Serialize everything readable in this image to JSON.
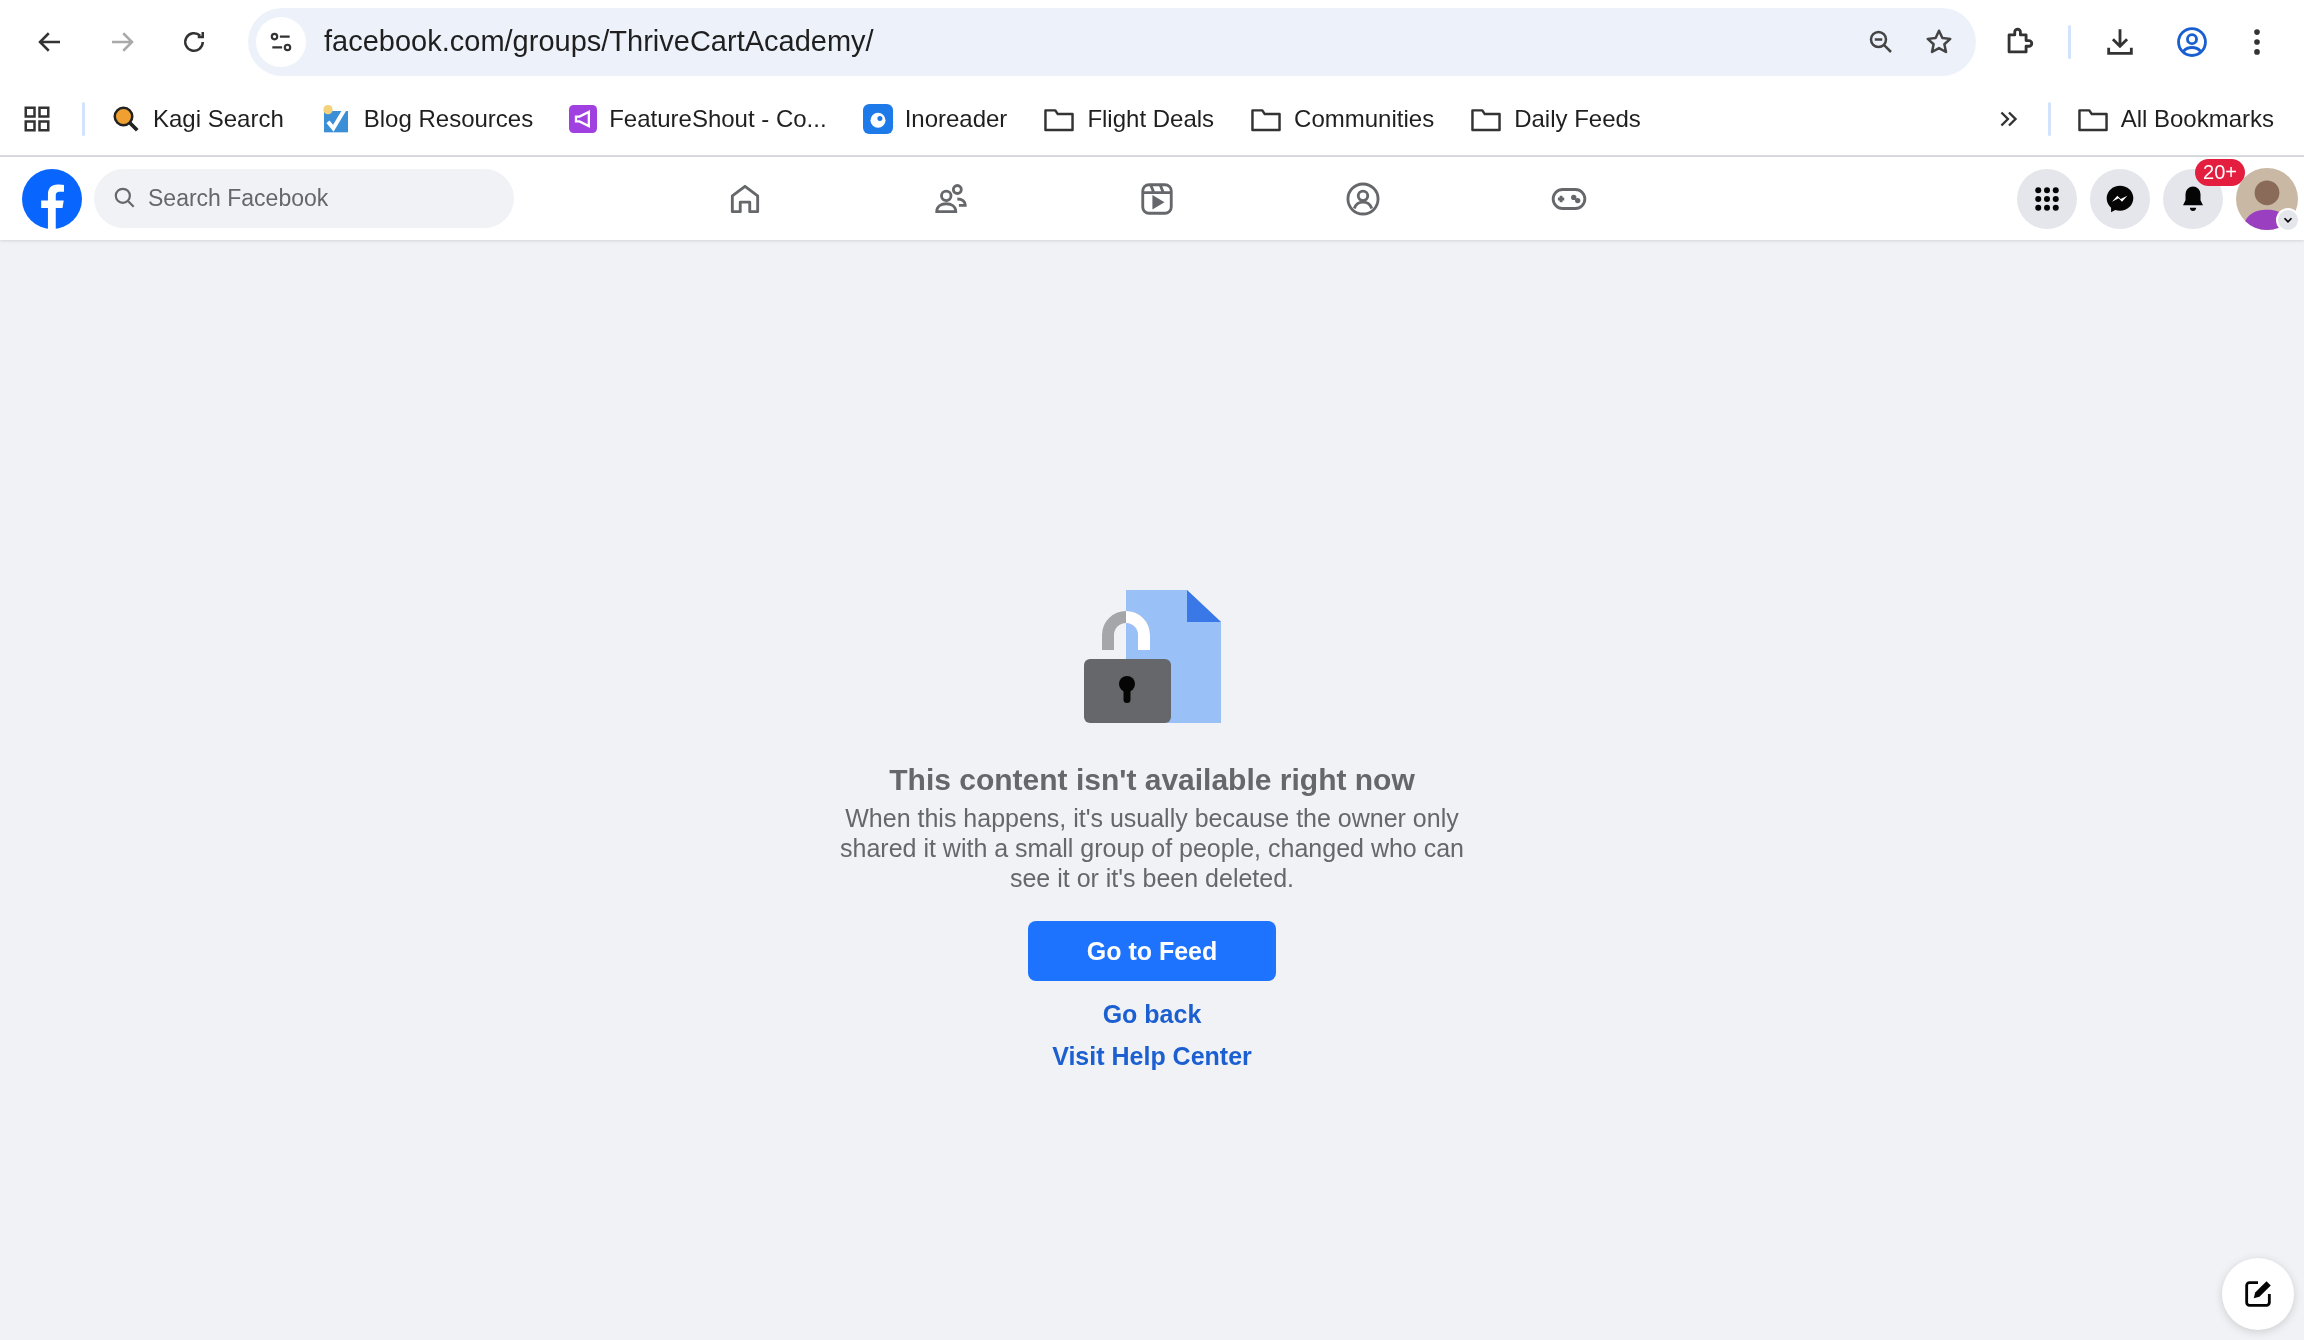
{
  "browser": {
    "nav_buttons": [
      {
        "kind": "back",
        "disabled": false
      },
      {
        "kind": "forward",
        "disabled": true
      },
      {
        "kind": "reload",
        "disabled": false
      }
    ],
    "url": "facebook.com/groups/ThriveCartAcademy/",
    "bookmarks": [
      {
        "kind": "kagi",
        "label": "Kagi Search"
      },
      {
        "kind": "blog",
        "label": "Blog Resources"
      },
      {
        "kind": "featureshout",
        "label": "FeatureShout - Co..."
      },
      {
        "kind": "inoreader",
        "label": "Inoreader"
      },
      {
        "kind": "folder",
        "label": "Flight Deals"
      },
      {
        "kind": "folder",
        "label": "Communities"
      },
      {
        "kind": "folder",
        "label": "Daily Feeds"
      }
    ],
    "all_bookmarks": "All Bookmarks"
  },
  "header": {
    "search": {
      "placeholder": "Search Facebook"
    },
    "nav": [
      {
        "kind": "home"
      },
      {
        "kind": "friends"
      },
      {
        "kind": "video"
      },
      {
        "kind": "groups"
      },
      {
        "kind": "gaming"
      }
    ],
    "notifications_badge": "20+"
  },
  "message": {
    "title": "This content isn't available right now",
    "body": "When this happens, it's usually because the owner only shared it with a small group of people, changed who can see it or it's been deleted.",
    "primary_button": "Go to Feed",
    "links": [
      "Go back",
      "Visit Help Center"
    ]
  }
}
